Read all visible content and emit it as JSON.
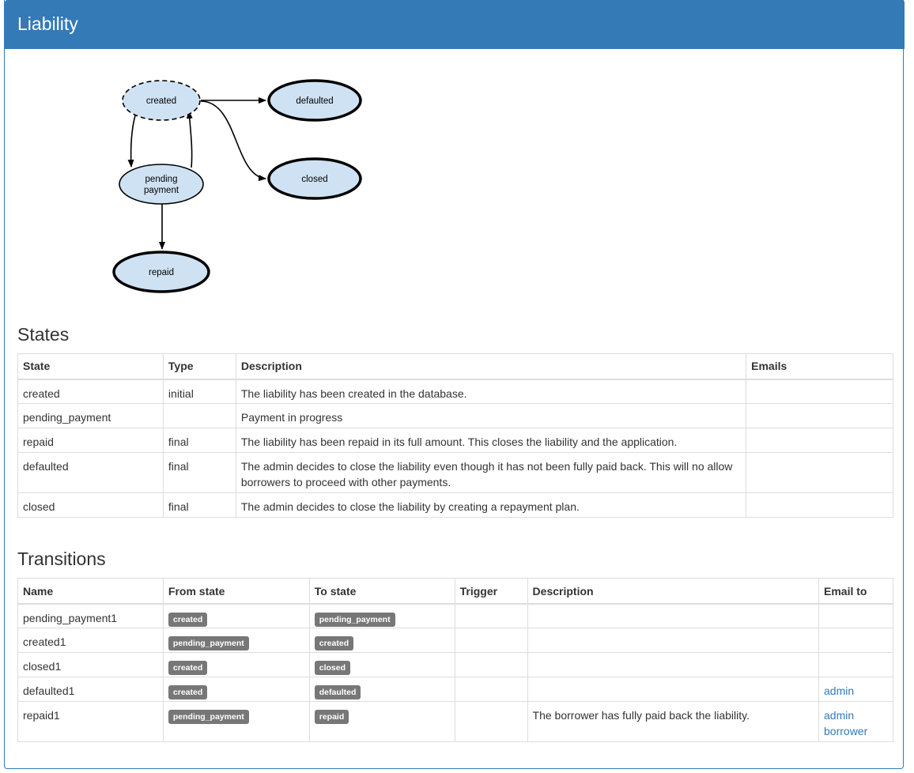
{
  "panel": {
    "title": "Liability"
  },
  "diagram": {
    "nodes": {
      "created": "created",
      "defaulted": "defaulted",
      "closed": "closed",
      "pending_1": "pending",
      "pending_2": "payment",
      "repaid": "repaid"
    }
  },
  "states": {
    "heading": "States",
    "columns": [
      "State",
      "Type",
      "Description",
      "Emails"
    ],
    "rows": [
      {
        "state": "created",
        "type": "initial",
        "description": "The liability has been created in the database.",
        "emails": ""
      },
      {
        "state": "pending_payment",
        "type": "",
        "description": "Payment in progress",
        "emails": ""
      },
      {
        "state": "repaid",
        "type": "final",
        "description": "The liability has been repaid in its full amount. This closes the liability and the application.",
        "emails": ""
      },
      {
        "state": "defaulted",
        "type": "final",
        "description": "The admin decides to close the liability even though it has not been fully paid back. This will no allow borrowers to proceed with other payments.",
        "emails": ""
      },
      {
        "state": "closed",
        "type": "final",
        "description": "The admin decides to close the liability by creating a repayment plan.",
        "emails": ""
      }
    ]
  },
  "transitions": {
    "heading": "Transitions",
    "columns": [
      "Name",
      "From state",
      "To state",
      "Trigger",
      "Description",
      "Email to"
    ],
    "rows": [
      {
        "name": "pending_payment1",
        "from": "created",
        "to": "pending_payment",
        "trigger": "",
        "description": "",
        "email_to": []
      },
      {
        "name": "created1",
        "from": "pending_payment",
        "to": "created",
        "trigger": "",
        "description": "",
        "email_to": []
      },
      {
        "name": "closed1",
        "from": "created",
        "to": "closed",
        "trigger": "",
        "description": "",
        "email_to": []
      },
      {
        "name": "defaulted1",
        "from": "created",
        "to": "defaulted",
        "trigger": "",
        "description": "",
        "email_to": [
          "admin"
        ]
      },
      {
        "name": "repaid1",
        "from": "pending_payment",
        "to": "repaid",
        "trigger": "",
        "description": "The borrower has fully paid back the liability.",
        "email_to": [
          "admin",
          "borrower"
        ]
      }
    ]
  },
  "colors": {
    "header_bg": "#337ab7",
    "node_fill": "#cfe2f3",
    "label_bg": "#777777",
    "link": "#337ab7"
  }
}
